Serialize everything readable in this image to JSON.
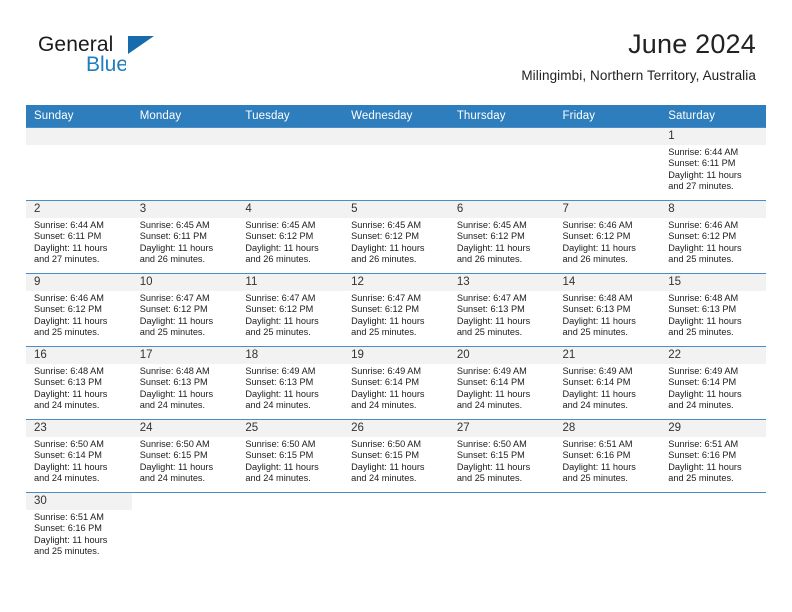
{
  "logo": {
    "word_one": "General",
    "word_two": "Blue",
    "triangle_color": "#156bac",
    "blue_color": "#1f7cc0"
  },
  "header": {
    "title": "June 2024",
    "subtitle": "Milingimbi, Northern Territory, Australia"
  },
  "theme": {
    "header_bar": "#2e7ebd",
    "daynum_band": "#f2f2f2",
    "row_rule": "#4a8cc7",
    "text": "#1c1c1c"
  },
  "weekdays": [
    "Sunday",
    "Monday",
    "Tuesday",
    "Wednesday",
    "Thursday",
    "Friday",
    "Saturday"
  ],
  "labels": {
    "sunrise_prefix": "Sunrise:",
    "sunset_prefix": "Sunset:",
    "daylight_prefix": "Daylight:"
  },
  "weeks": [
    [
      {
        "blank": true
      },
      {
        "blank": true
      },
      {
        "blank": true
      },
      {
        "blank": true
      },
      {
        "blank": true
      },
      {
        "blank": true
      },
      {
        "day": "1",
        "sunrise": "Sunrise: 6:44 AM",
        "sunset": "Sunset: 6:11 PM",
        "daylight_1": "Daylight: 11 hours",
        "daylight_2": "and 27 minutes."
      }
    ],
    [
      {
        "day": "2",
        "sunrise": "Sunrise: 6:44 AM",
        "sunset": "Sunset: 6:11 PM",
        "daylight_1": "Daylight: 11 hours",
        "daylight_2": "and 27 minutes."
      },
      {
        "day": "3",
        "sunrise": "Sunrise: 6:45 AM",
        "sunset": "Sunset: 6:11 PM",
        "daylight_1": "Daylight: 11 hours",
        "daylight_2": "and 26 minutes."
      },
      {
        "day": "4",
        "sunrise": "Sunrise: 6:45 AM",
        "sunset": "Sunset: 6:12 PM",
        "daylight_1": "Daylight: 11 hours",
        "daylight_2": "and 26 minutes."
      },
      {
        "day": "5",
        "sunrise": "Sunrise: 6:45 AM",
        "sunset": "Sunset: 6:12 PM",
        "daylight_1": "Daylight: 11 hours",
        "daylight_2": "and 26 minutes."
      },
      {
        "day": "6",
        "sunrise": "Sunrise: 6:45 AM",
        "sunset": "Sunset: 6:12 PM",
        "daylight_1": "Daylight: 11 hours",
        "daylight_2": "and 26 minutes."
      },
      {
        "day": "7",
        "sunrise": "Sunrise: 6:46 AM",
        "sunset": "Sunset: 6:12 PM",
        "daylight_1": "Daylight: 11 hours",
        "daylight_2": "and 26 minutes."
      },
      {
        "day": "8",
        "sunrise": "Sunrise: 6:46 AM",
        "sunset": "Sunset: 6:12 PM",
        "daylight_1": "Daylight: 11 hours",
        "daylight_2": "and 25 minutes."
      }
    ],
    [
      {
        "day": "9",
        "sunrise": "Sunrise: 6:46 AM",
        "sunset": "Sunset: 6:12 PM",
        "daylight_1": "Daylight: 11 hours",
        "daylight_2": "and 25 minutes."
      },
      {
        "day": "10",
        "sunrise": "Sunrise: 6:47 AM",
        "sunset": "Sunset: 6:12 PM",
        "daylight_1": "Daylight: 11 hours",
        "daylight_2": "and 25 minutes."
      },
      {
        "day": "11",
        "sunrise": "Sunrise: 6:47 AM",
        "sunset": "Sunset: 6:12 PM",
        "daylight_1": "Daylight: 11 hours",
        "daylight_2": "and 25 minutes."
      },
      {
        "day": "12",
        "sunrise": "Sunrise: 6:47 AM",
        "sunset": "Sunset: 6:12 PM",
        "daylight_1": "Daylight: 11 hours",
        "daylight_2": "and 25 minutes."
      },
      {
        "day": "13",
        "sunrise": "Sunrise: 6:47 AM",
        "sunset": "Sunset: 6:13 PM",
        "daylight_1": "Daylight: 11 hours",
        "daylight_2": "and 25 minutes."
      },
      {
        "day": "14",
        "sunrise": "Sunrise: 6:48 AM",
        "sunset": "Sunset: 6:13 PM",
        "daylight_1": "Daylight: 11 hours",
        "daylight_2": "and 25 minutes."
      },
      {
        "day": "15",
        "sunrise": "Sunrise: 6:48 AM",
        "sunset": "Sunset: 6:13 PM",
        "daylight_1": "Daylight: 11 hours",
        "daylight_2": "and 25 minutes."
      }
    ],
    [
      {
        "day": "16",
        "sunrise": "Sunrise: 6:48 AM",
        "sunset": "Sunset: 6:13 PM",
        "daylight_1": "Daylight: 11 hours",
        "daylight_2": "and 24 minutes."
      },
      {
        "day": "17",
        "sunrise": "Sunrise: 6:48 AM",
        "sunset": "Sunset: 6:13 PM",
        "daylight_1": "Daylight: 11 hours",
        "daylight_2": "and 24 minutes."
      },
      {
        "day": "18",
        "sunrise": "Sunrise: 6:49 AM",
        "sunset": "Sunset: 6:13 PM",
        "daylight_1": "Daylight: 11 hours",
        "daylight_2": "and 24 minutes."
      },
      {
        "day": "19",
        "sunrise": "Sunrise: 6:49 AM",
        "sunset": "Sunset: 6:14 PM",
        "daylight_1": "Daylight: 11 hours",
        "daylight_2": "and 24 minutes."
      },
      {
        "day": "20",
        "sunrise": "Sunrise: 6:49 AM",
        "sunset": "Sunset: 6:14 PM",
        "daylight_1": "Daylight: 11 hours",
        "daylight_2": "and 24 minutes."
      },
      {
        "day": "21",
        "sunrise": "Sunrise: 6:49 AM",
        "sunset": "Sunset: 6:14 PM",
        "daylight_1": "Daylight: 11 hours",
        "daylight_2": "and 24 minutes."
      },
      {
        "day": "22",
        "sunrise": "Sunrise: 6:49 AM",
        "sunset": "Sunset: 6:14 PM",
        "daylight_1": "Daylight: 11 hours",
        "daylight_2": "and 24 minutes."
      }
    ],
    [
      {
        "day": "23",
        "sunrise": "Sunrise: 6:50 AM",
        "sunset": "Sunset: 6:14 PM",
        "daylight_1": "Daylight: 11 hours",
        "daylight_2": "and 24 minutes."
      },
      {
        "day": "24",
        "sunrise": "Sunrise: 6:50 AM",
        "sunset": "Sunset: 6:15 PM",
        "daylight_1": "Daylight: 11 hours",
        "daylight_2": "and 24 minutes."
      },
      {
        "day": "25",
        "sunrise": "Sunrise: 6:50 AM",
        "sunset": "Sunset: 6:15 PM",
        "daylight_1": "Daylight: 11 hours",
        "daylight_2": "and 24 minutes."
      },
      {
        "day": "26",
        "sunrise": "Sunrise: 6:50 AM",
        "sunset": "Sunset: 6:15 PM",
        "daylight_1": "Daylight: 11 hours",
        "daylight_2": "and 24 minutes."
      },
      {
        "day": "27",
        "sunrise": "Sunrise: 6:50 AM",
        "sunset": "Sunset: 6:15 PM",
        "daylight_1": "Daylight: 11 hours",
        "daylight_2": "and 25 minutes."
      },
      {
        "day": "28",
        "sunrise": "Sunrise: 6:51 AM",
        "sunset": "Sunset: 6:16 PM",
        "daylight_1": "Daylight: 11 hours",
        "daylight_2": "and 25 minutes."
      },
      {
        "day": "29",
        "sunrise": "Sunrise: 6:51 AM",
        "sunset": "Sunset: 6:16 PM",
        "daylight_1": "Daylight: 11 hours",
        "daylight_2": "and 25 minutes."
      }
    ],
    [
      {
        "day": "30",
        "sunrise": "Sunrise: 6:51 AM",
        "sunset": "Sunset: 6:16 PM",
        "daylight_1": "Daylight: 11 hours",
        "daylight_2": "and 25 minutes."
      },
      {
        "blank": true
      },
      {
        "blank": true
      },
      {
        "blank": true
      },
      {
        "blank": true
      },
      {
        "blank": true
      },
      {
        "blank": true
      }
    ]
  ]
}
